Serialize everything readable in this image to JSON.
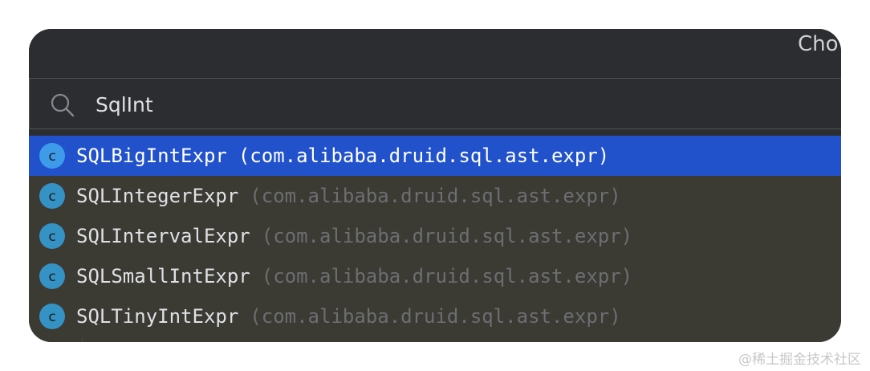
{
  "window": {
    "title": "Cho"
  },
  "search": {
    "value": "SqlInt",
    "icon": "search-icon"
  },
  "results": [
    {
      "class_name": "SQLBigIntExpr",
      "package": "(com.alibaba.druid.sql.ast.expr)",
      "icon": "class-icon",
      "selected": true
    },
    {
      "class_name": "SQLIntegerExpr",
      "package": "(com.alibaba.druid.sql.ast.expr)",
      "icon": "class-icon",
      "selected": false
    },
    {
      "class_name": "SQLIntervalExpr",
      "package": "(com.alibaba.druid.sql.ast.expr)",
      "icon": "class-icon",
      "selected": false
    },
    {
      "class_name": "SQLSmallIntExpr",
      "package": "(com.alibaba.druid.sql.ast.expr)",
      "icon": "class-icon",
      "selected": false
    },
    {
      "class_name": "SQLTinyIntExpr",
      "package": "(com.alibaba.druid.sql.ast.expr)",
      "icon": "class-icon",
      "selected": false
    }
  ],
  "watermark": "@稀土掘金技术社区",
  "colors": {
    "background": "#2b2d30",
    "list_background": "#3b3a33",
    "selection": "#2152cc",
    "class_icon": "#3592c4",
    "class_icon_selected": "#3d9be9",
    "text": "#dfe1e5",
    "muted_text": "#6c6e72"
  }
}
